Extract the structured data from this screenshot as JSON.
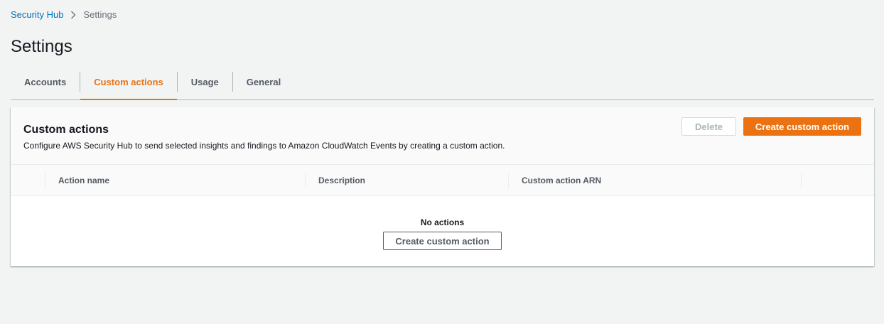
{
  "breadcrumb": {
    "root": "Security Hub",
    "current": "Settings"
  },
  "page": {
    "title": "Settings"
  },
  "tabs": [
    {
      "label": "Accounts",
      "active": false
    },
    {
      "label": "Custom actions",
      "active": true
    },
    {
      "label": "Usage",
      "active": false
    },
    {
      "label": "General",
      "active": false
    }
  ],
  "panel": {
    "title": "Custom actions",
    "description": "Configure AWS Security Hub to send selected insights and findings to Amazon CloudWatch Events by creating a custom action.",
    "delete_label": "Delete",
    "create_label": "Create custom action"
  },
  "table": {
    "columns": [
      "Action name",
      "Description",
      "Custom action ARN"
    ],
    "empty_title": "No actions",
    "empty_button": "Create custom action"
  },
  "colors": {
    "accent": "#ec7211",
    "link": "#0073bb",
    "background": "#f2f3f3"
  },
  "icons": {
    "breadcrumb_separator": "chevron-right-icon"
  }
}
